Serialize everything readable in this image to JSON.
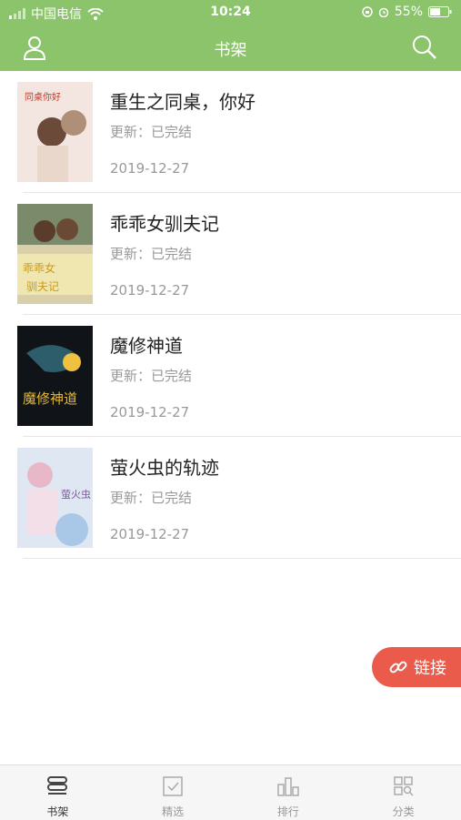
{
  "status_bar": {
    "carrier": "中国电信",
    "time": "10:24",
    "battery": "55%"
  },
  "nav": {
    "title": "书架",
    "icons": [
      "user-icon",
      "search-icon"
    ]
  },
  "books": [
    {
      "title": "重生之同桌，你好",
      "update": "更新：已完结",
      "date": "2019-12-27"
    },
    {
      "title": "乖乖女驯夫记",
      "update": "更新：已完结",
      "date": "2019-12-27"
    },
    {
      "title": "魔修神道",
      "update": "更新：已完结",
      "date": "2019-12-27"
    },
    {
      "title": "萤火虫的轨迹",
      "update": "更新：已完结",
      "date": "2019-12-27"
    }
  ],
  "fab": {
    "label": "链接",
    "color": "#ea5b4b"
  },
  "tabs": [
    {
      "label": "书架",
      "active": true
    },
    {
      "label": "精选",
      "active": false
    },
    {
      "label": "排行",
      "active": false
    },
    {
      "label": "分类",
      "active": false
    }
  ],
  "colors": {
    "accent": "#8bc46a"
  }
}
